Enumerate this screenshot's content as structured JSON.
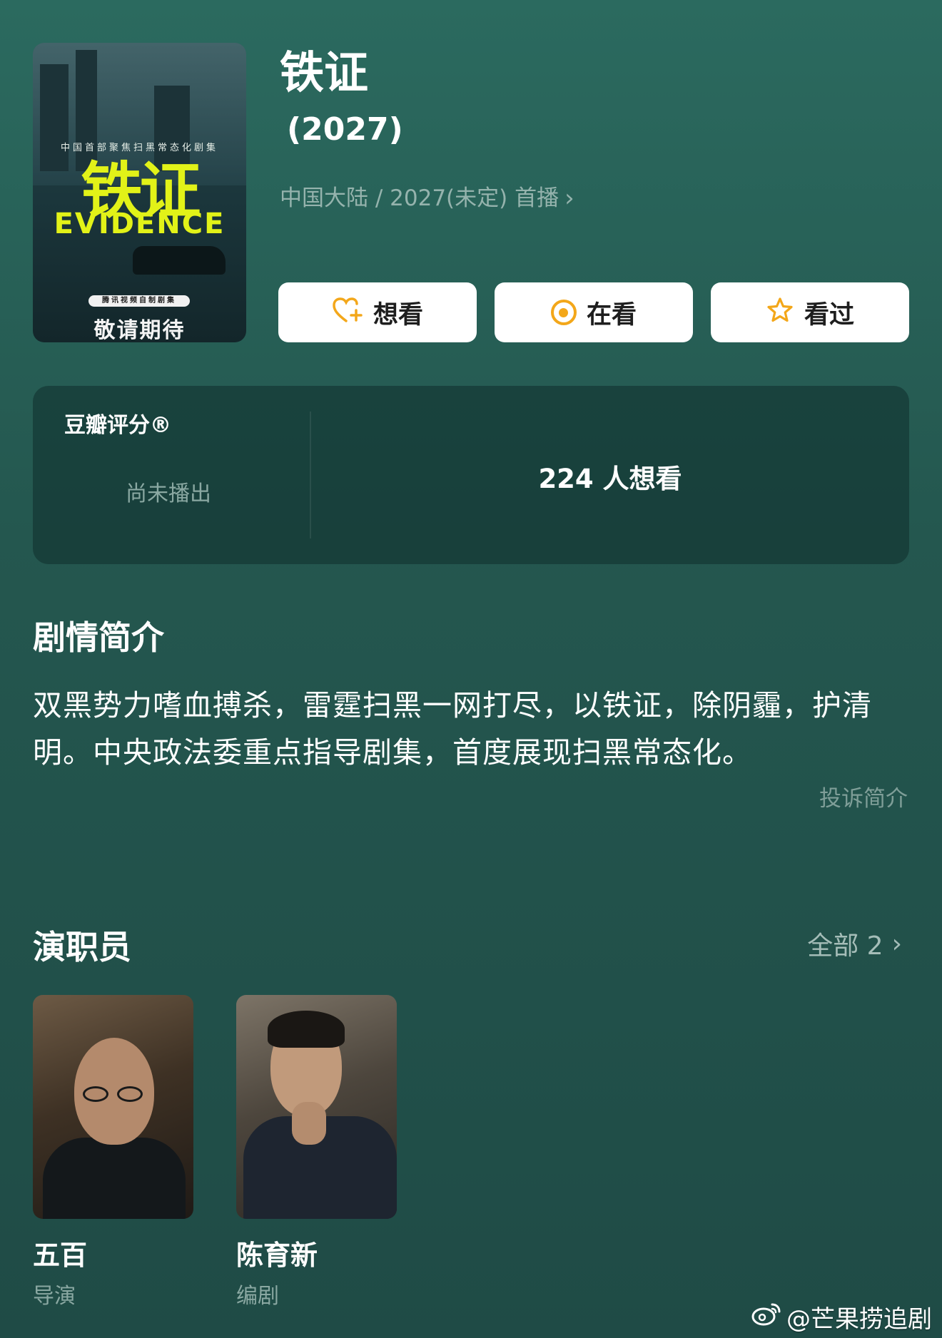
{
  "poster": {
    "tagline": "中国首部聚焦扫黑常态化剧集",
    "big_title": "铁证",
    "en_title": "EVIDENCE",
    "badge": "腾讯视频自制剧集",
    "coming": "敬请期待"
  },
  "header": {
    "title": "铁证",
    "year": "(2027)",
    "meta": "中国大陆 / 2027(未定) 首播"
  },
  "actions": [
    {
      "label": "想看",
      "icon": "heart-plus-icon"
    },
    {
      "label": "在看",
      "icon": "target-icon"
    },
    {
      "label": "看过",
      "icon": "star-icon"
    }
  ],
  "rating": {
    "label": "豆瓣评分®",
    "status": "尚未播出",
    "want_count": "224 人想看"
  },
  "synopsis": {
    "title": "剧情简介",
    "text": "双黑势力嗜血搏杀，雷霆扫黑一网打尽，以铁证，除阴霾，护清明。中央政法委重点指导剧集，首度展现扫黑常态化。",
    "report": "投诉简介"
  },
  "cast": {
    "title": "演职员",
    "all_label": "全部 2",
    "people": [
      {
        "name": "五百",
        "role": "导演"
      },
      {
        "name": "陈育新",
        "role": "编剧"
      }
    ]
  },
  "watermark": "@芒果捞追剧",
  "colors": {
    "accent": "#f3a71a",
    "poster_title": "#e2f218",
    "background": "#24574f"
  }
}
